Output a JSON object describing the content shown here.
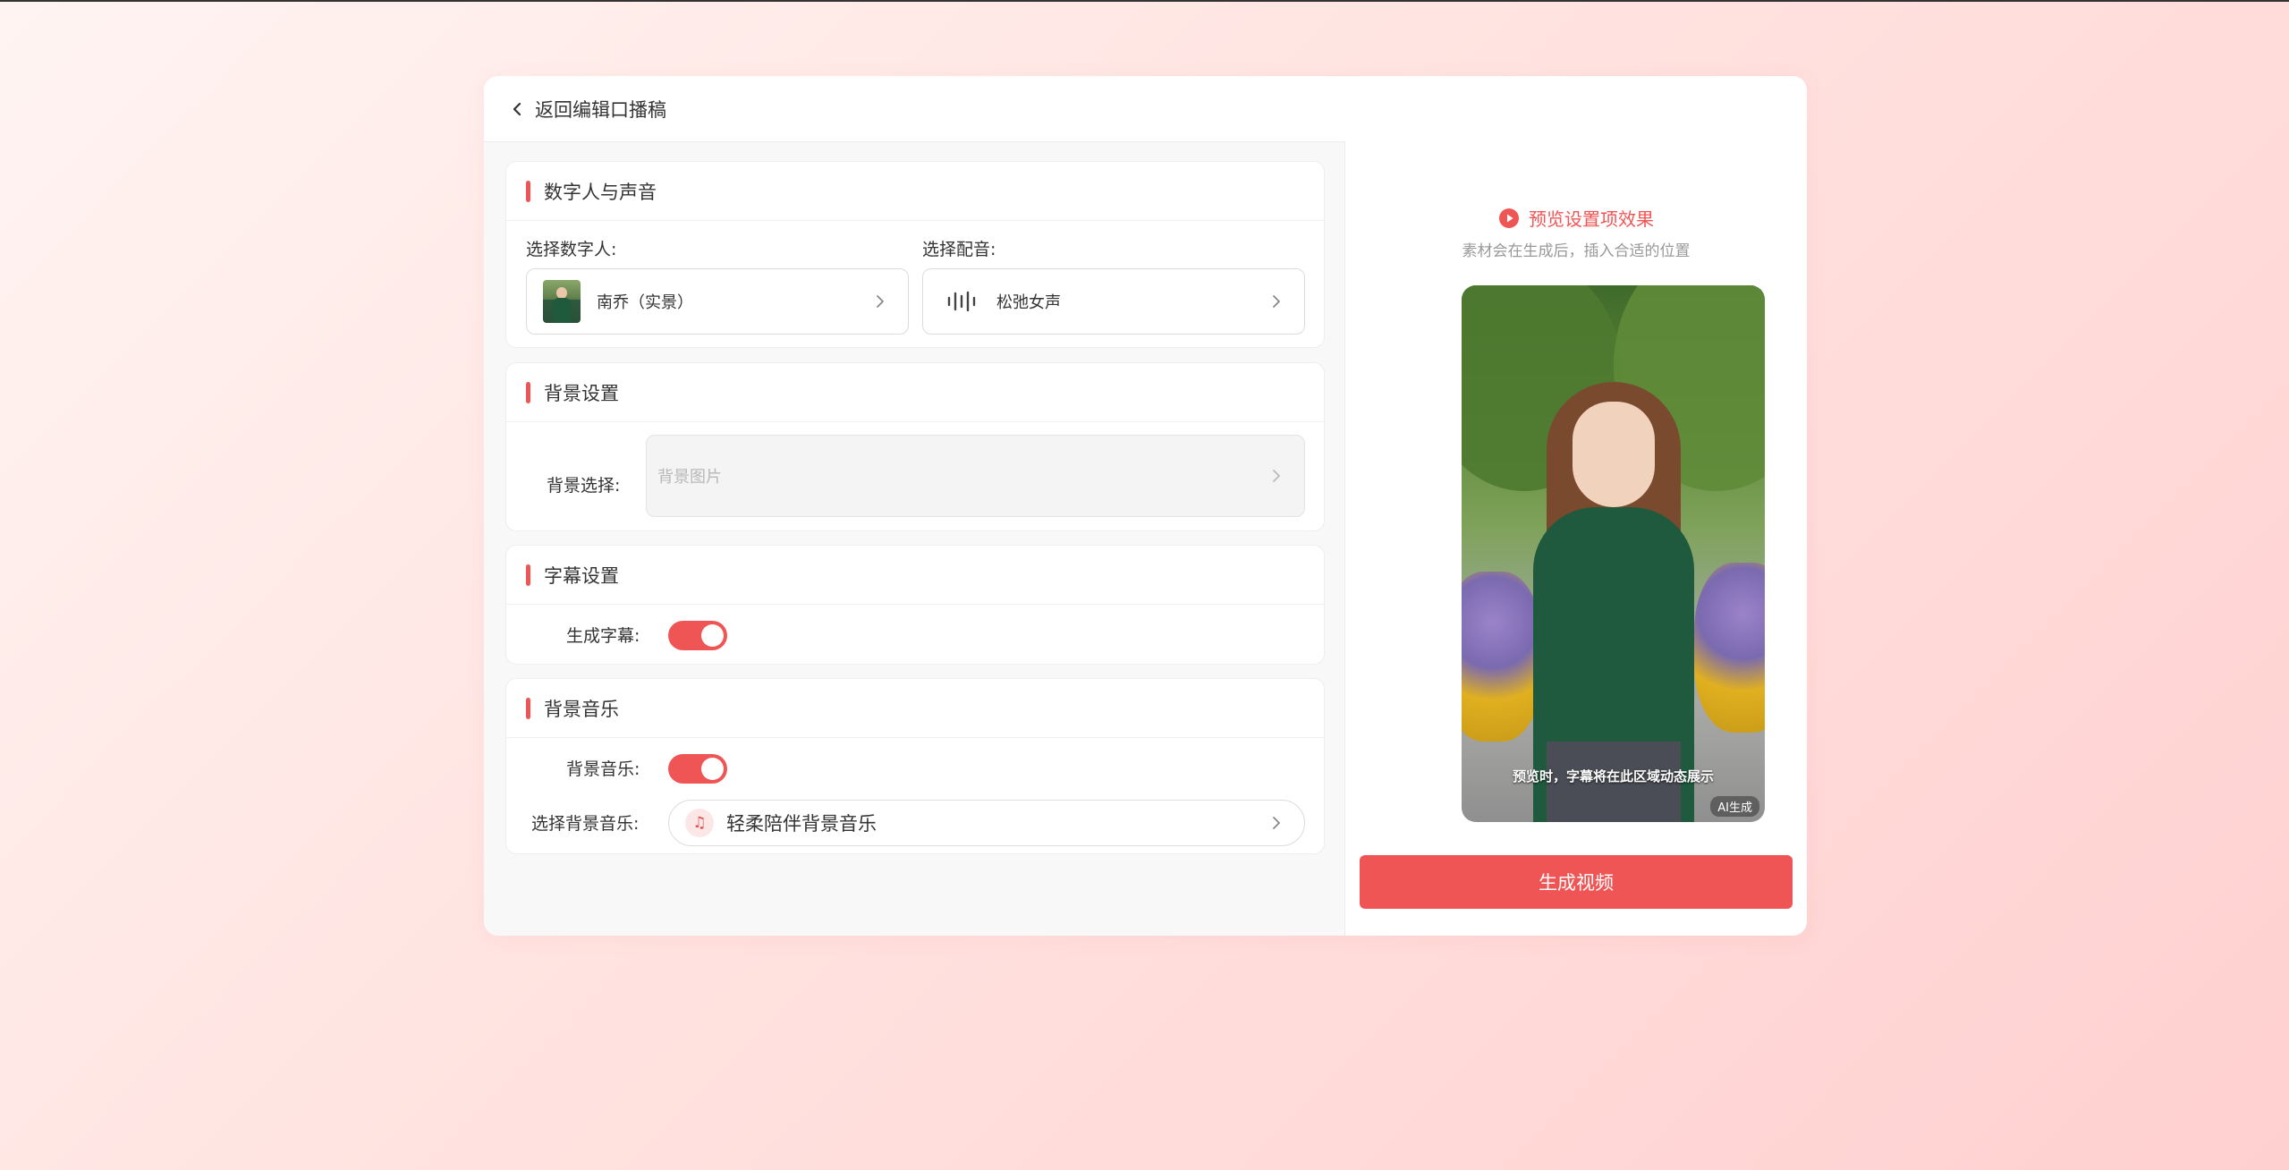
{
  "back": {
    "label": "返回编辑口播稿"
  },
  "sections": {
    "avatar_voice": {
      "title": "数字人与声音",
      "avatar_label": "选择数字人:",
      "avatar_value": "南乔（实景）",
      "voice_label": "选择配音:",
      "voice_value": "松弛女声"
    },
    "background": {
      "title": "背景设置",
      "label": "背景选择:",
      "placeholder": "背景图片"
    },
    "subtitle": {
      "title": "字幕设置",
      "label": "生成字幕:",
      "enabled": true
    },
    "music": {
      "title": "背景音乐",
      "toggle_label": "背景音乐:",
      "enabled": true,
      "select_label": "选择背景音乐:",
      "select_value": "轻柔陪伴背景音乐"
    }
  },
  "preview": {
    "title": "预览设置项效果",
    "subtitle": "素材会在生成后，插入合适的位置",
    "caption": "预览时，字幕将在此区域动态展示",
    "ai_badge": "AI生成"
  },
  "generate_button": "生成视频",
  "colors": {
    "accent": "#f05555",
    "muted_text": "#999999"
  },
  "icons": [
    "chevron-left-icon",
    "chevron-right-icon",
    "waveform-icon",
    "music-note-icon",
    "play-circle-icon"
  ]
}
